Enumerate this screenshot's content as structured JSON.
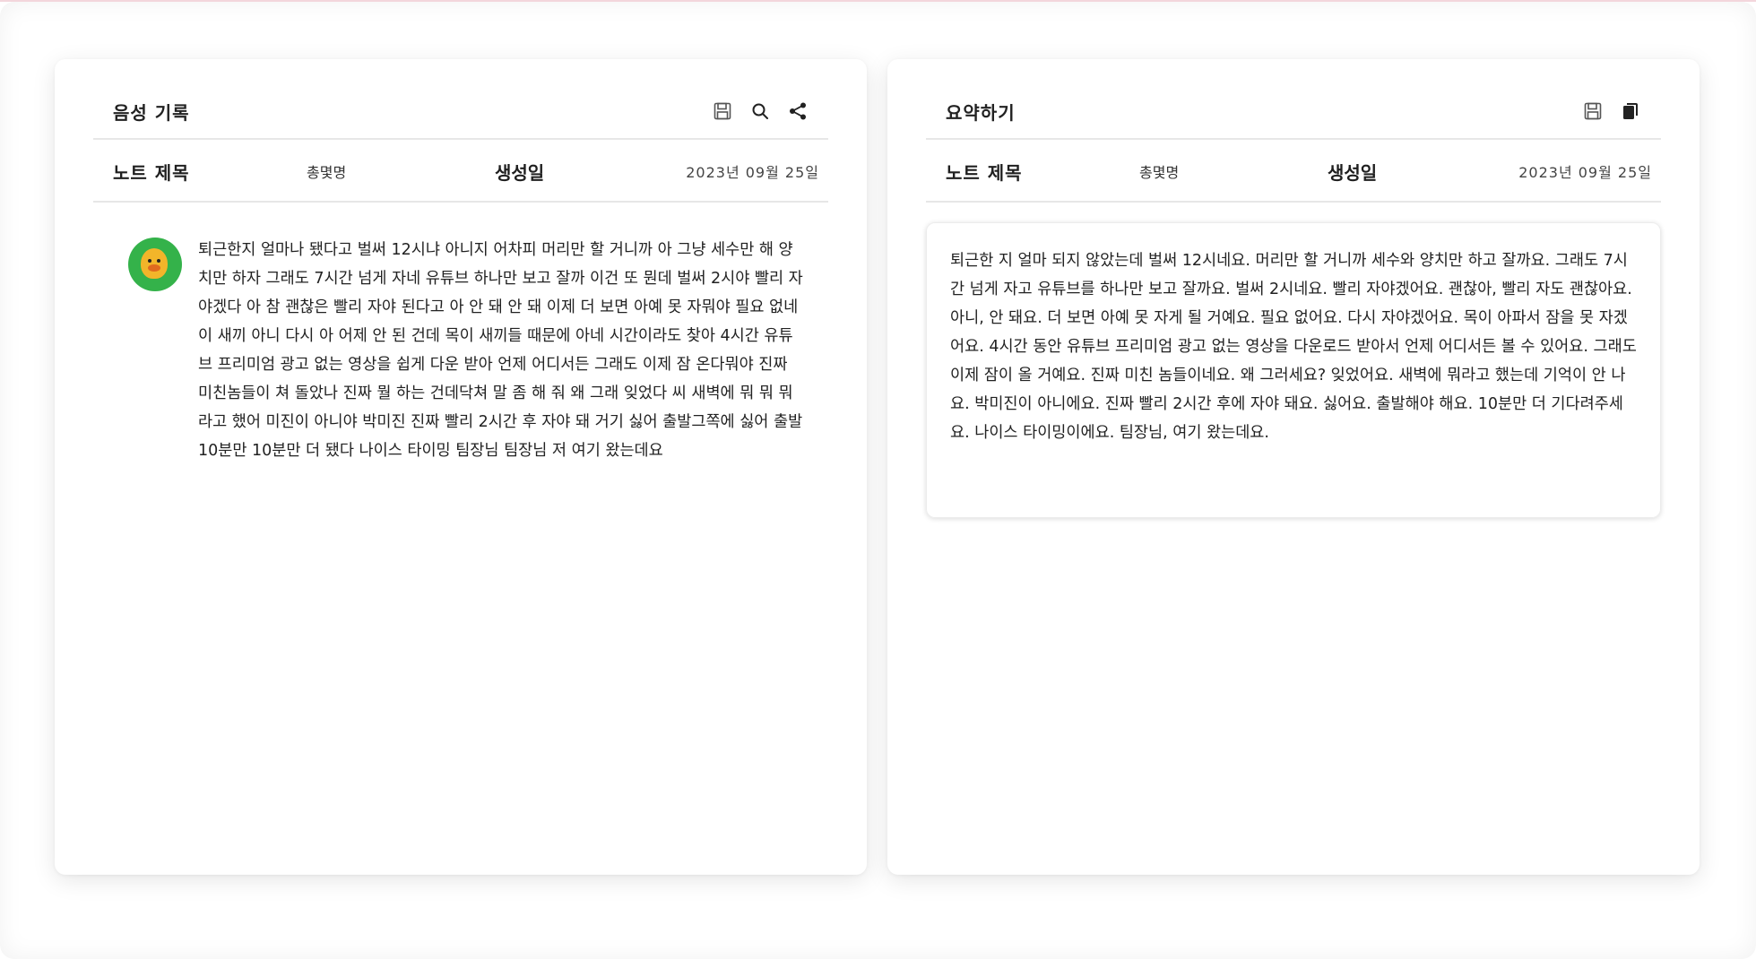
{
  "left_panel": {
    "title": "음성  기록",
    "tools": [
      "save-icon",
      "search-icon",
      "share-icon"
    ],
    "meta": {
      "note_title": "노트  제목",
      "author": "총몇명",
      "created_label": "생성일",
      "date": "2023년  09월  25일"
    },
    "transcript": "퇴근한지 얼마나 됐다고 벌써 12시냐 아니지 어차피 머리만 할 거니까 아 그냥 세수만 해 양치만 하자 그래도 7시간 넘게 자네 유튜브 하나만 보고 잘까 이건 또 뭔데 벌써 2시야 빨리 자야겠다 아 참 괜찮은 빨리 자야 된다고 아 안 돼 안 돼 이제 더 보면 아예 못 자뭐야 필요 없네이 새끼 아니 다시 아 어제 안 된 건데 목이 새끼들 때문에 아네 시간이라도 찾아 4시간 유튜브 프리미엄 광고 없는 영상을 쉽게 다운 받아 언제 어디서든 그래도 이제 잠 온다뭐야 진짜 미친놈들이 쳐 돌았나 진짜 뭘 하는 건데닥쳐 말 좀 해 줘 왜 그래 잊었다 씨 새벽에 뭐 뭐 뭐라고 했어 미진이 아니야 박미진 진짜 빨리 2시간 후 자야 돼 거기 싫어 출발그쪽에 싫어 출발 10분만 10분만 더 됐다 나이스 타이밍 팀장님 팀장님 저 여기 왔는데요"
  },
  "right_panel": {
    "title": "요약하기",
    "tools": [
      "save-icon",
      "copy-icon"
    ],
    "meta": {
      "note_title": "노트  제목",
      "author": "총몇명",
      "created_label": "생성일",
      "date": "2023년  09월  25일"
    },
    "summary": "퇴근한 지 얼마 되지 않았는데 벌써 12시네요. 머리만 할 거니까 세수와 양치만 하고 잘까요. 그래도 7시간 넘게 자고 유튜브를 하나만 보고 잘까요. 벌써 2시네요. 빨리 자야겠어요. 괜찮아, 빨리 자도 괜찮아요. 아니, 안 돼요. 더 보면 아예 못 자게 될 거예요. 필요 없어요. 다시 자야겠어요. 목이 아파서 잠을 못 자겠어요. 4시간 동안 유튜브 프리미엄 광고 없는 영상을 다운로드 받아서 언제 어디서든 볼 수 있어요. 그래도 이제 잠이 올 거예요. 진짜 미친 놈들이네요. 왜 그러세요? 잊었어요. 새벽에 뭐라고 했는데 기억이 안 나요. 박미진이 아니에요. 진짜 빨리 2시간 후에 자야 돼요. 싫어요. 출발해야 해요. 10분만 더 기다려주세요. 나이스 타이밍이에요. 팀장님, 여기 왔는데요."
  }
}
